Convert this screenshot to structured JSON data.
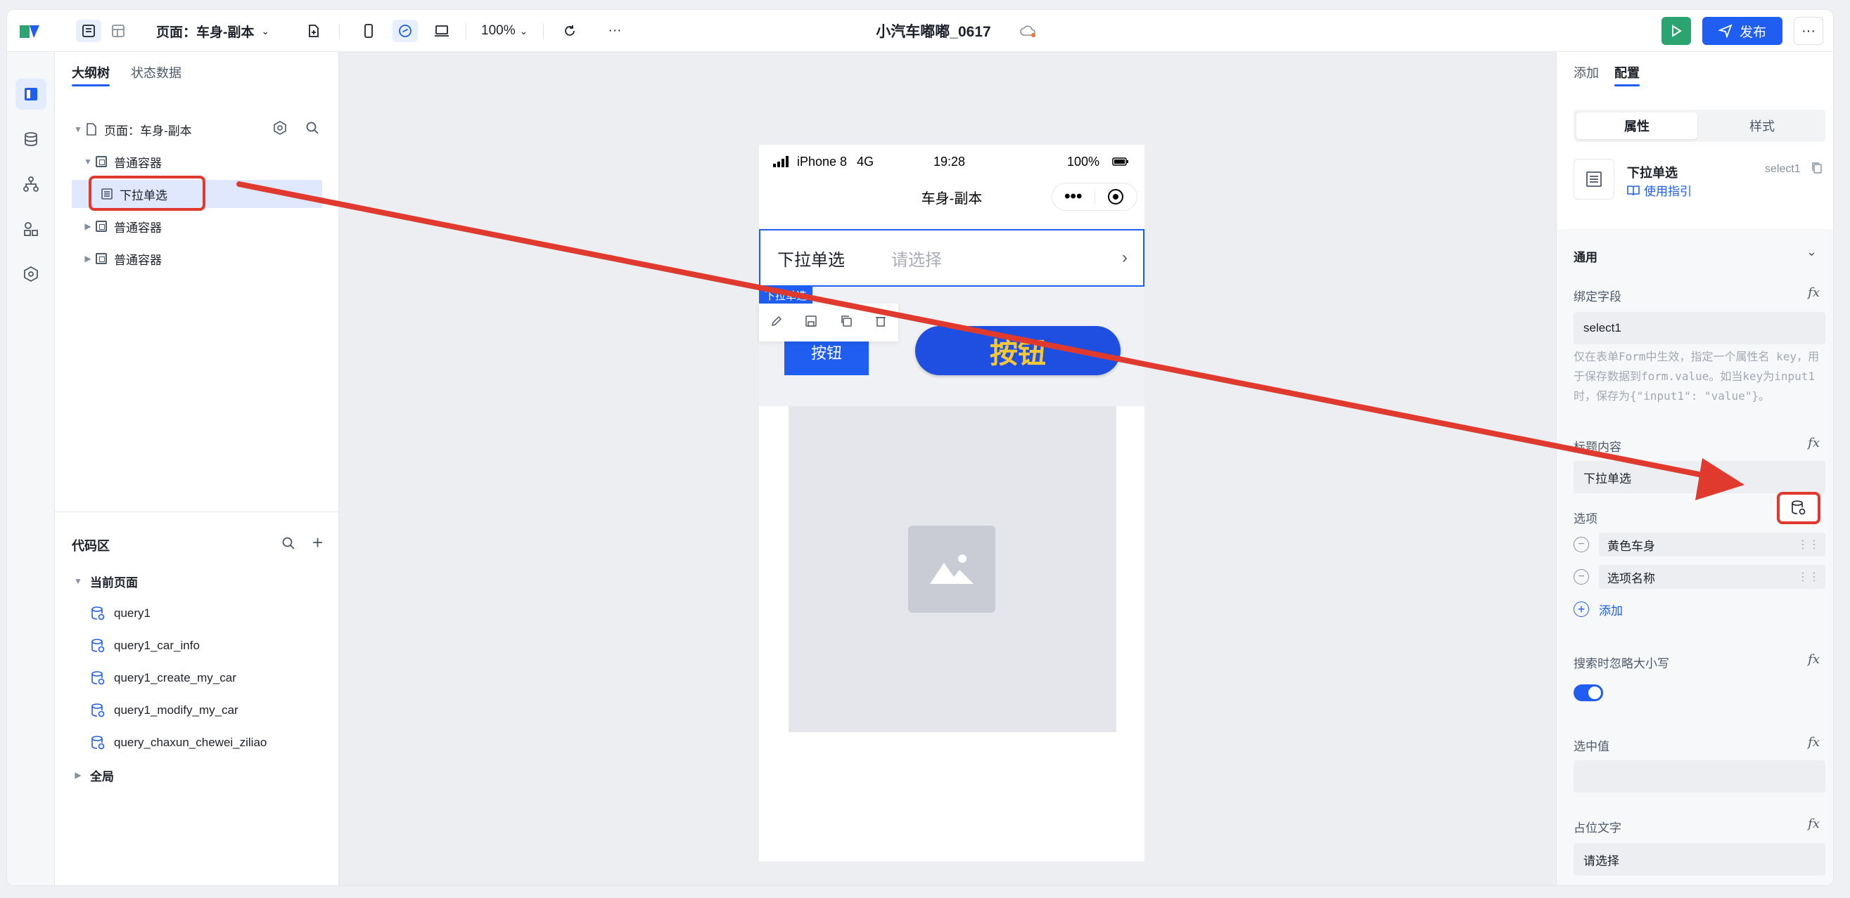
{
  "toolbar": {
    "page_select": "页面：车身-副本",
    "zoom": "100%",
    "app_title": "小汽车嘟嘟_0617",
    "publish_label": "发布"
  },
  "outline": {
    "tabs": [
      "大纲树",
      "状态数据"
    ],
    "tree": [
      {
        "label": "页面：车身-副本"
      },
      {
        "label": "普通容器"
      },
      {
        "label": "下拉单选"
      },
      {
        "label": "普通容器"
      },
      {
        "label": "普通容器"
      }
    ],
    "code_area": {
      "title": "代码区",
      "current_page": "当前页面",
      "queries": [
        "query1",
        "query1_car_info",
        "query1_create_my_car",
        "query1_modify_my_car",
        "query_chaxun_chewei_ziliao"
      ],
      "global": "全局"
    }
  },
  "phone": {
    "carrier": "iPhone 8",
    "network": "4G",
    "time": "19:28",
    "battery": "100%",
    "page_title": "车身-副本",
    "select_label": "下拉单选",
    "select_placeholder": "请选择",
    "selected_tag": "下拉单选",
    "button_small": "按钮",
    "button_large": "按钮"
  },
  "props": {
    "tabs": [
      "添加",
      "配置"
    ],
    "segments": [
      "属性",
      "样式"
    ],
    "component_name": "下拉单选",
    "component_id": "select1",
    "guide_link": "使用指引",
    "section_title": "通用",
    "bind_field_label": "绑定字段",
    "bind_field_value": "select1",
    "help_text": "仅在表单Form中生效，指定一个属性名 key，用于保存数据到form.value。如当key为input1时，保存为{\"input1\": \"value\"}。",
    "title_label": "标题内容",
    "title_value": "下拉单选",
    "options_label": "选项",
    "options": [
      "黄色车身",
      "选项名称"
    ],
    "add_label": "添加",
    "ignore_case_label": "搜索时忽略大小写",
    "ignore_case_on": true,
    "selected_value_label": "选中值",
    "placeholder_label": "占位文字",
    "placeholder_value": "请选择"
  },
  "colors": {
    "accent": "#1f5ef0",
    "annotation_red": "#e03a2e",
    "run_green": "#2ba471",
    "button_text_yellow": "#f3c736"
  }
}
